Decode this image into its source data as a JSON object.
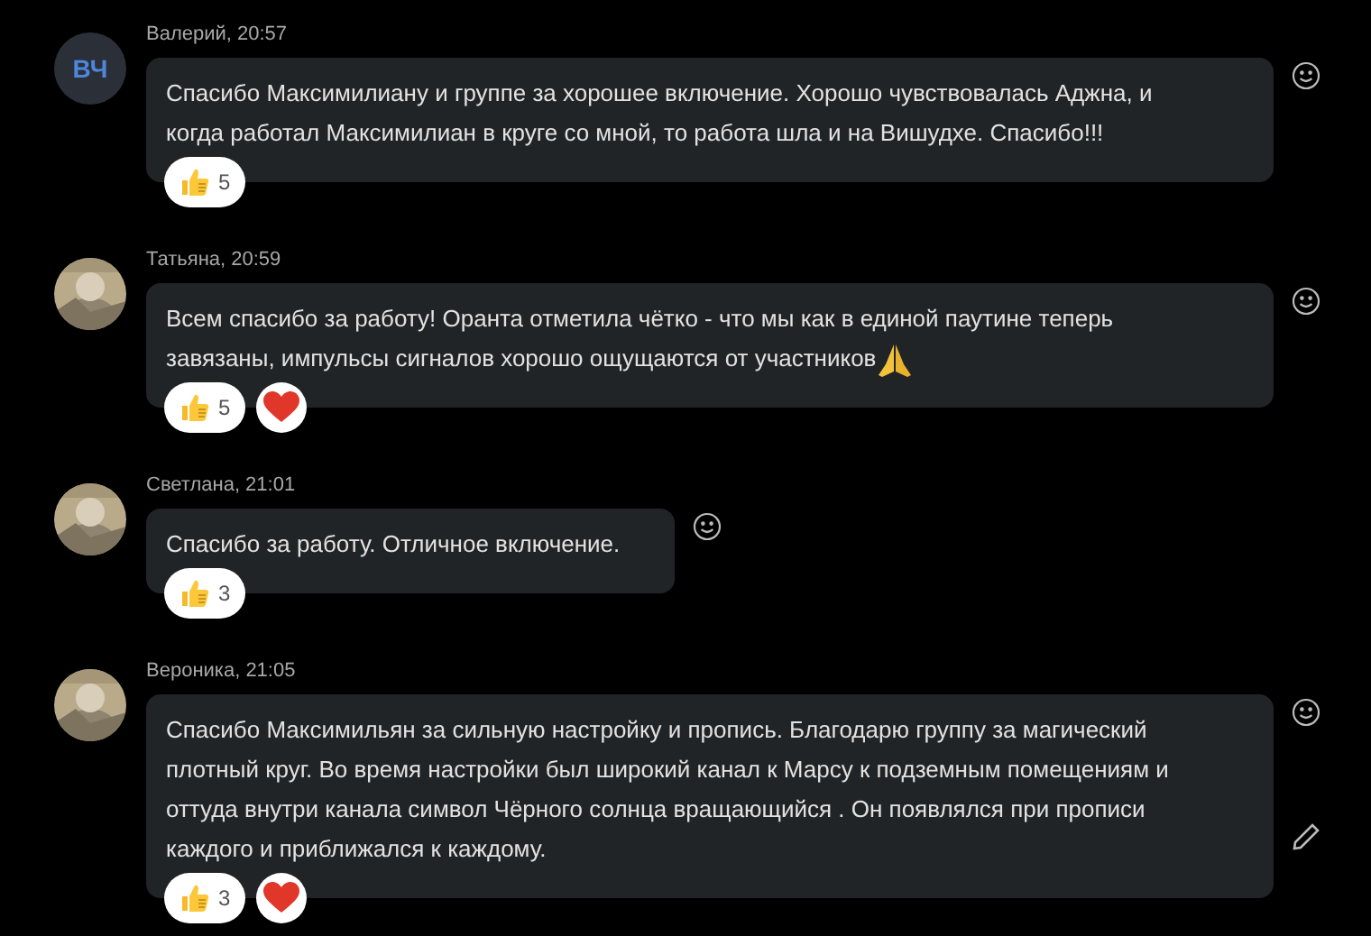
{
  "messages": [
    {
      "author": "Валерий, 20:57",
      "avatar": {
        "kind": "initials",
        "text": "ВЧ"
      },
      "text": "Спасибо Максимилиану и группе за хорошее включение. Хорошо чувствовалась Аджна, и\nкогда работал Максимилиан в круге со мной, то работа шла и на Вишудхе. Спасибо!!!",
      "full_width": true,
      "editable": false,
      "reactions": [
        {
          "kind": "like",
          "count": "5"
        }
      ]
    },
    {
      "author": "Татьяна, 20:59",
      "avatar": {
        "kind": "picture"
      },
      "text": "Всем спасибо за работу! Оранта отметила чётко - что мы как в единой паутине теперь\nзавязаны, импульсы сигналов хорошо ощущаются от участников",
      "emoji": true,
      "full_width": true,
      "editable": false,
      "reactions": [
        {
          "kind": "like",
          "count": "5"
        },
        {
          "kind": "heart"
        }
      ]
    },
    {
      "author": "Светлана, 21:01",
      "avatar": {
        "kind": "picture"
      },
      "text": "Спасибо за работу. Отличное включение.",
      "full_width": false,
      "editable": false,
      "reactions": [
        {
          "kind": "like",
          "count": "3"
        }
      ]
    },
    {
      "author": "Вероника, 21:05",
      "avatar": {
        "kind": "picture"
      },
      "text": "Спасибо Максимильян за сильную настройку и пропись. Благодарю группу за магический\nплотный  круг. Во время настройки был широкий канал к Марсу к подземным помещениям и\nоттуда внутри канала символ Чёрного солнца вращающийся . Он появлялся при прописи\nкаждого и приближался к каждому.",
      "full_width": true,
      "editable": true,
      "reactions": [
        {
          "kind": "like",
          "count": "3"
        },
        {
          "kind": "heart"
        }
      ]
    }
  ]
}
